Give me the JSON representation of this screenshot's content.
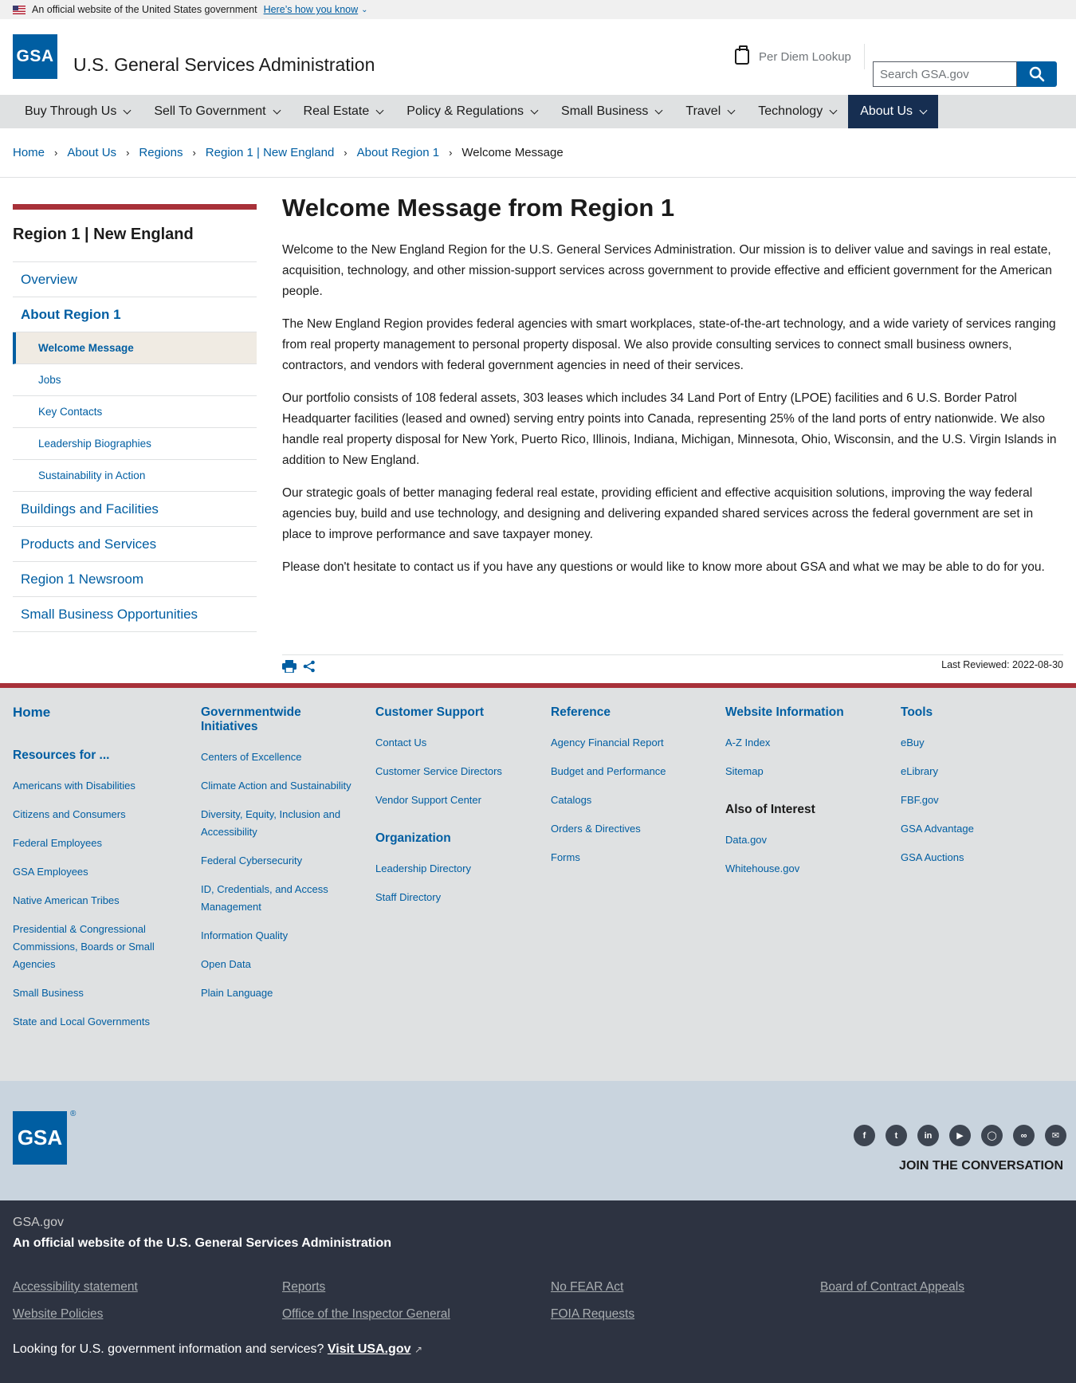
{
  "gov_banner": {
    "text": "An official website of the United States government",
    "how_link": "Here’s how you know"
  },
  "header": {
    "logo": "GSA",
    "title": "U.S. General Services Administration",
    "per_diem": "Per Diem Lookup",
    "search_placeholder": "Search GSA.gov"
  },
  "nav": [
    {
      "label": "Buy Through Us"
    },
    {
      "label": "Sell To Government"
    },
    {
      "label": "Real Estate"
    },
    {
      "label": "Policy & Regulations"
    },
    {
      "label": "Small Business"
    },
    {
      "label": "Travel"
    },
    {
      "label": "Technology"
    },
    {
      "label": "About Us",
      "active": true
    }
  ],
  "breadcrumb": [
    "Home",
    "About Us",
    "Regions",
    "Region 1 | New England",
    "About Region 1",
    "Welcome Message"
  ],
  "sidenav": {
    "title": "Region 1 | New England",
    "overview": "Overview",
    "about": "About Region 1",
    "sub": [
      "Welcome Message",
      "Jobs",
      "Key Contacts",
      "Leadership Biographies",
      "Sustainability in Action"
    ],
    "rest": [
      "Buildings and Facilities",
      "Products and Services",
      "Region 1 Newsroom",
      "Small Business Opportunities"
    ]
  },
  "content": {
    "title": "Welcome Message from Region 1",
    "paragraphs": [
      "Welcome to the New England Region for the U.S. General Services Administration. Our mission is to deliver value and savings in real estate, acquisition, technology, and other mission-support services across government to provide effective and efficient government for the American people.",
      "The New England Region provides federal agencies with smart workplaces, state-of-the-art technology, and a wide variety of services ranging from real property management to personal property disposal. We also provide consulting services to connect small business owners, contractors, and vendors with federal government agencies in need of their services.",
      "Our portfolio consists of 108 federal assets, 303 leases which includes 34 Land Port of Entry (LPOE) facilities and 6 U.S. Border Patrol Headquarter facilities (leased and owned) serving entry points into Canada, representing 25% of the land ports of entry nationwide. We also handle real property disposal for New York, Puerto Rico, Illinois, Indiana, Michigan, Minnesota, Ohio, Wisconsin, and the U.S. Virgin Islands in addition to New England.",
      "Our strategic goals of better managing federal real estate, providing efficient and effective acquisition solutions, improving the way federal agencies buy, build and use technology, and designing and delivering expanded shared services across the federal government are set in place to improve performance and save taxpayer money.",
      "Please don't hesitate to contact us if you have any questions or would like to know more about GSA and what we may be able to do for you."
    ],
    "last_reviewed": "Last Reviewed: 2022-08-30"
  },
  "footer": {
    "home": "Home",
    "resources_head": "Resources for ...",
    "resources": [
      "Americans with Disabilities",
      "Citizens and Consumers",
      "Federal Employees",
      "GSA Employees",
      "Native American Tribes",
      "Presidential & Congressional Commissions, Boards or Small Agencies",
      "Small Business",
      "State and Local Governments"
    ],
    "gov_head": "Governmentwide Initiatives",
    "gov": [
      "Centers of Excellence",
      "Climate Action and Sustainability",
      "Diversity, Equity, Inclusion and Accessibility",
      "Federal Cybersecurity",
      "ID, Credentials, and Access Management",
      "Information Quality",
      "Open Data",
      "Plain Language"
    ],
    "cs_head": "Customer Support",
    "cs": [
      "Contact Us",
      "Customer Service Directors",
      "Vendor Support Center"
    ],
    "org_head": "Organization",
    "org": [
      "Leadership Directory",
      "Staff Directory"
    ],
    "ref_head": "Reference",
    "ref": [
      "Agency Financial Report",
      "Budget and Performance",
      "Catalogs",
      "Orders & Directives",
      "Forms"
    ],
    "web_head": "Website Information",
    "web": [
      "A-Z Index",
      "Sitemap"
    ],
    "also_head": "Also of Interest",
    "also": [
      "Data.gov",
      "Whitehouse.gov"
    ],
    "tools_head": "Tools",
    "tools": [
      "eBuy",
      "eLibrary",
      "FBF.gov",
      "GSA Advantage",
      "GSA Auctions"
    ]
  },
  "footer_mid": {
    "logo": "GSA",
    "join": "JOIN THE CONVERSATION",
    "social_icons": [
      "facebook-icon",
      "twitter-icon",
      "linkedin-icon",
      "youtube-icon",
      "instagram-icon",
      "blog-icon",
      "email-icon"
    ]
  },
  "footer_bottom": {
    "site": "GSA.gov",
    "official": "An official website of the U.S. General Services Administration",
    "links": [
      "Accessibility statement",
      "Reports",
      "No FEAR Act",
      "Board of Contract Appeals",
      "Website Policies",
      "Office of the Inspector General",
      "FOIA Requests"
    ],
    "looking": "Looking for U.S. government information and services?",
    "visit": "Visit USA.gov"
  },
  "colors": {
    "primary": "#005ea2",
    "accent_red": "#a83139",
    "nav_active": "#162e51",
    "footer_dark": "#2d3341"
  }
}
